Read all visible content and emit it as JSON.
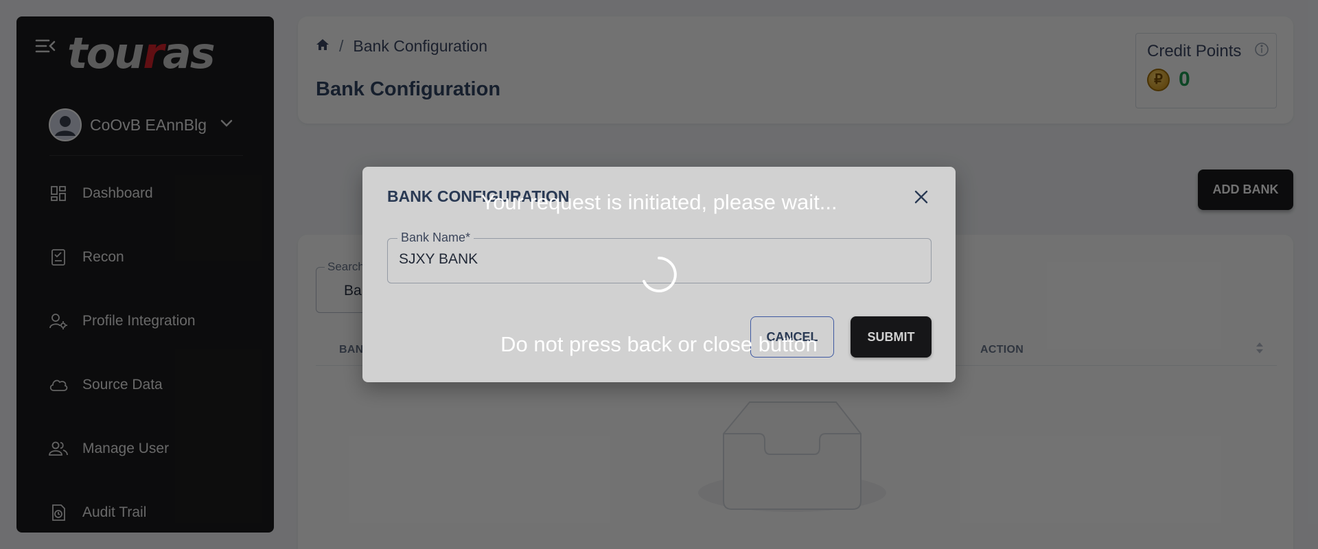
{
  "app": {
    "logo_prefix": "tou",
    "logo_accent": "r",
    "logo_suffix": "as"
  },
  "user": {
    "name": "CoOvB EAnnBlg"
  },
  "sidebar": {
    "items": [
      {
        "label": "Dashboard",
        "icon": "dashboard-icon"
      },
      {
        "label": "Recon",
        "icon": "recon-icon"
      },
      {
        "label": "Profile Integration",
        "icon": "profile-integration-icon"
      },
      {
        "label": "Source Data",
        "icon": "cloud-icon"
      },
      {
        "label": "Manage User",
        "icon": "users-icon"
      },
      {
        "label": "Audit Trail",
        "icon": "audit-trail-icon"
      }
    ]
  },
  "header": {
    "breadcrumb_current": "Bank Configuration",
    "breadcrumb_sep": "/",
    "title": "Bank Configuration",
    "credit_label": "Credit Points",
    "credit_coin": "₽",
    "credit_value": "0"
  },
  "toolbar": {
    "add_bank_label": "ADD BANK"
  },
  "table": {
    "search_label": "Search",
    "search_value": "Ban",
    "col_bank": "BANK NAME",
    "col_action": "ACTION"
  },
  "dialog": {
    "title": "BANK CONFIGURATION",
    "field_label": "Bank Name*",
    "field_value": "SJXY BANK",
    "cancel_label": "CANCEL",
    "submit_label": "SUBMIT"
  },
  "loading": {
    "message_top": "Your request is initiated, please wait...",
    "message_bottom": "Do not press back or close button"
  },
  "colors": {
    "accent": "#1c1c1e",
    "brand_red": "#d9232d",
    "credit_green": "#1f9d55"
  }
}
